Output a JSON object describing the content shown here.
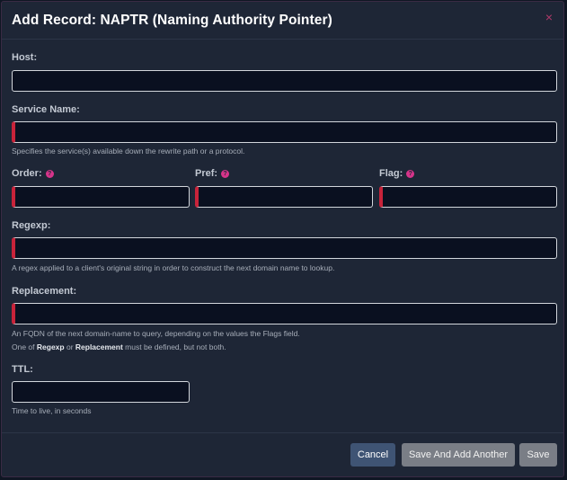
{
  "modal": {
    "title": "Add Record: NAPTR (Naming Authority Pointer)",
    "close_glyph": "×"
  },
  "fields": {
    "host": {
      "label": "Host:",
      "value": ""
    },
    "service_name": {
      "label": "Service Name:",
      "value": "",
      "hint": "Specifies the service(s) available down the rewrite path or a protocol."
    },
    "order": {
      "label": "Order:",
      "value": "",
      "help_glyph": "?"
    },
    "pref": {
      "label": "Pref:",
      "value": "",
      "help_glyph": "?"
    },
    "flag": {
      "label": "Flag:",
      "value": "",
      "help_glyph": "?"
    },
    "regexp": {
      "label": "Regexp:",
      "value": "",
      "hint": "A regex applied to a client's original string in order to construct the next domain name to lookup."
    },
    "replacement": {
      "label": "Replacement:",
      "value": "",
      "hint": "An FQDN of the next domain-name to query, depending on the values the Flags field.",
      "note_prefix": "One of ",
      "note_regexp": "Regexp",
      "note_or": " or ",
      "note_replacement": "Replacement",
      "note_suffix": " must be defined, but not both."
    },
    "ttl": {
      "label": "TTL:",
      "value": "",
      "hint": "Time to live, in seconds"
    }
  },
  "footer": {
    "cancel_label": "Cancel",
    "save_another_label": "Save And Add Another",
    "save_label": "Save"
  },
  "colors": {
    "required_marker": "#c8233a",
    "help_icon": "#d6348a",
    "cancel_button": "#3f5474",
    "disabled_button": "#7a7e86"
  }
}
